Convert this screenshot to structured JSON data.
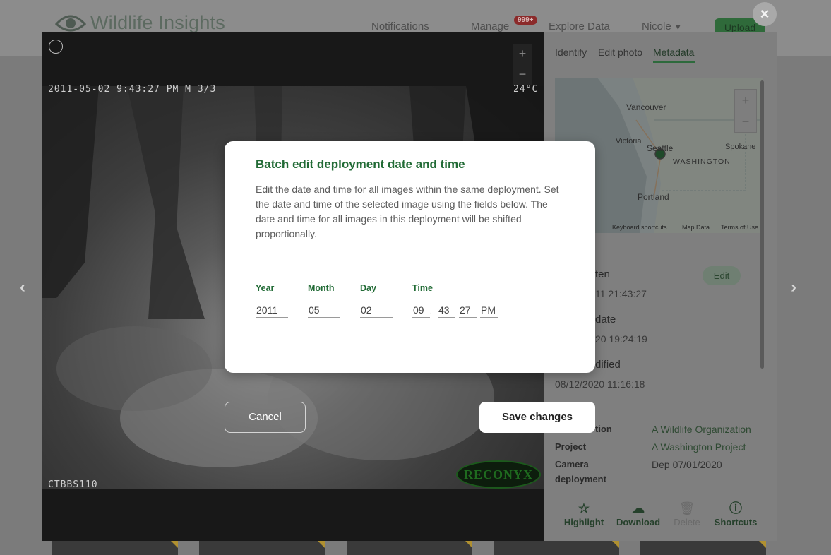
{
  "app": {
    "logo_text": "Wildlife Insights",
    "nav": {
      "notifications": "Notifications",
      "manage": "Manage",
      "manage_badge": "999+",
      "explore": "Explore Data",
      "user": "Nicole",
      "upload": "Upload"
    }
  },
  "viewer": {
    "overlay_top_left": "2011-05-02 9:43:27 PM   M 3/3",
    "overlay_top_right": "24°C",
    "overlay_bottom_left": "CTBBS110",
    "watermark": "RECONYX",
    "zoom_in": "+",
    "zoom_out": "−",
    "prev": "‹",
    "next": "›"
  },
  "panel": {
    "tabs": [
      "Identify",
      "Edit photo",
      "Metadata"
    ],
    "active_tab": "Metadata",
    "map": {
      "labels": [
        "Vancouver",
        "Victoria",
        "Seattle",
        "Spokane",
        "WASHINGTON",
        "Portland"
      ],
      "footer": [
        "Keyboard shortcuts",
        "Map Data",
        "Terms of Use"
      ]
    },
    "meta": {
      "taken_label": "ten",
      "taken_value": "11 21:43:27",
      "upload_label": "date",
      "upload_value": "20 19:24:19",
      "modified_label": "dified",
      "modified_value": "08/12/2020 11:16:18",
      "org_label": "tion",
      "org_value": "A Wildlife Organization",
      "project_label": "Project",
      "project_value": "A Washington Project",
      "deployment_label_1": "Camera",
      "deployment_label_2": "deployment",
      "deployment_value": "Dep 07/01/2020",
      "edit": "Edit"
    },
    "actions": [
      "Highlight",
      "Download",
      "Delete",
      "Shortcuts"
    ]
  },
  "dialog": {
    "title": "Batch edit deployment date and time",
    "description": "Edit the date and time for all images within the same deployment. Set the date and time of the selected image using the fields below. The date and time for all images in this deployment will be shifted proportionally.",
    "fields": {
      "year_label": "Year",
      "year": "2011",
      "month_label": "Month",
      "month": "05",
      "day_label": "Day",
      "day": "02",
      "time_label": "Time",
      "hour": "09",
      "minute": "43",
      "second": "27",
      "ampm": "PM"
    },
    "cancel": "Cancel",
    "save": "Save changes"
  },
  "colors": {
    "accent": "#226b36",
    "overlay": "#7b7b7b"
  }
}
